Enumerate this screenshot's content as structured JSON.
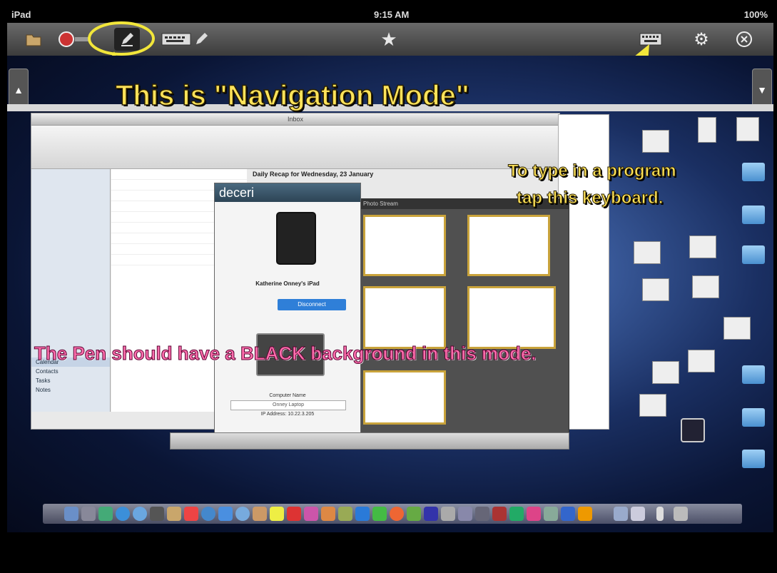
{
  "status_bar": {
    "device": "iPad",
    "time": "9:15 AM",
    "battery": "100%"
  },
  "toolbar": {
    "icons": [
      "folder-icon",
      "record-icon",
      "pen-icon",
      "keyboard-pen-icon",
      "star-icon",
      "keyboard-icon",
      "gear-icon",
      "close-icon"
    ]
  },
  "annotations": {
    "title": "This is \"Navigation Mode\"",
    "keyboard_line1": "To type in a program",
    "keyboard_line2": "tap this keyboard.",
    "pen_note": "The Pen should have a BLACK background in this mode."
  },
  "outlook": {
    "mail_header": "Daily Recap for Wednesday, 23 January",
    "nav_items": [
      "Calendar",
      "Contacts",
      "Tasks",
      "Notes"
    ]
  },
  "deceri": {
    "logo": "deceri",
    "device_name": "Katherine Onney's iPad",
    "disconnect_label": "Disconnect",
    "computer_name_label": "Computer Name",
    "computer_name_value": "Onney Laptop",
    "ip_label": "IP Address: 10.22.3.205"
  },
  "photos": {
    "title": "Photo Stream"
  },
  "colors": {
    "annotation_yellow": "#ffe35a",
    "annotation_pink": "#ff6fae",
    "highlight_circle": "#f2e63a"
  }
}
